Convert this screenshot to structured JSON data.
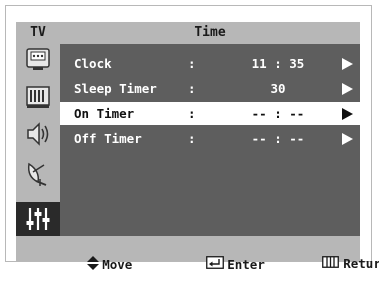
{
  "sidebar": {
    "tv_label": "TV",
    "icons": [
      "picture-icon",
      "sound-icon",
      "speaker-icon",
      "channel-icon",
      "setup-icon"
    ]
  },
  "header": {
    "title": "Time"
  },
  "menu": {
    "items": [
      {
        "label": "Clock",
        "colon": ":",
        "value": "11 : 35",
        "selected": false
      },
      {
        "label": "Sleep Timer",
        "colon": ":",
        "value": "30",
        "selected": false
      },
      {
        "label": "On Timer",
        "colon": ":",
        "value": "-- : --",
        "selected": true
      },
      {
        "label": "Off Timer",
        "colon": ":",
        "value": "-- : --",
        "selected": false
      }
    ]
  },
  "footer": {
    "move_label": "Move",
    "enter_label": "Enter",
    "return_label": "Return"
  },
  "colors": {
    "panel": "#5e5e5e",
    "frame": "#b7b7b7",
    "highlight": "#ffffff",
    "text_on_panel": "#ffffff"
  }
}
